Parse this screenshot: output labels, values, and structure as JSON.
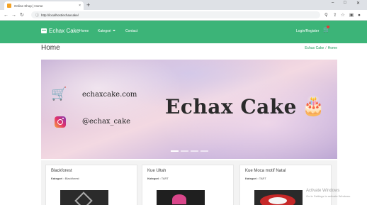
{
  "browser": {
    "tab_title": "Online Shop | Home",
    "tab_close": "×",
    "new_tab": "+",
    "url": "http://localhost/echaxcake/",
    "window_controls": [
      "–",
      "□",
      "✕"
    ]
  },
  "navbar": {
    "brand": "Echax Cake",
    "links": [
      "Home",
      "Kategori",
      "Contact"
    ],
    "login": "Login/Register",
    "colors": {
      "navbar": "#3cb478"
    }
  },
  "page": {
    "title": "Home",
    "breadcrumb": [
      "Echax Cake",
      "Home"
    ],
    "breadcrumb_sep": "/"
  },
  "banner": {
    "website": "echaxcake.com",
    "instagram": "@echax_cake",
    "headline": "Echax Cake",
    "slides": 4,
    "active_slide": 1
  },
  "products": [
    {
      "name": "Blackforest",
      "category_label": "Kategori :",
      "category": "Blackforest"
    },
    {
      "name": "Kue Ultah",
      "category_label": "Kategori :",
      "category": "TART"
    },
    {
      "name": "Kue Moca motif Natal",
      "category_label": "Kategori :",
      "category": "TART"
    }
  ],
  "watermark": {
    "title": "Activate Windows",
    "subtitle": "Go to Settings to activate Windows."
  }
}
